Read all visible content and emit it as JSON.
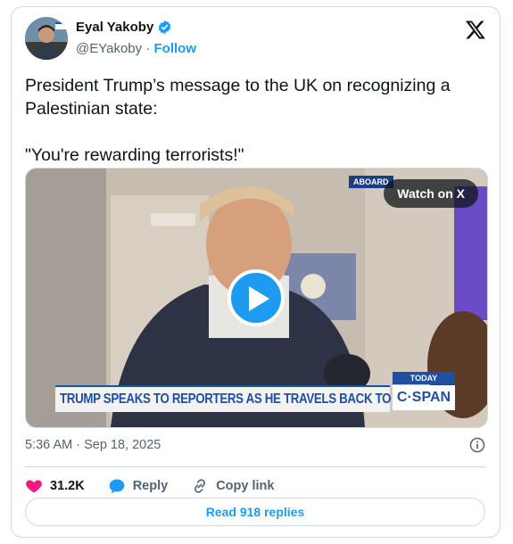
{
  "author": {
    "display_name": "Eyal Yakoby",
    "handle": "@EYakoby",
    "separator": "·",
    "follow_label": "Follow"
  },
  "tweet": {
    "text": "President Trump’s message to the UK on recognizing a Palestinian state:\n\n\"You're rewarding terrorists!\""
  },
  "media": {
    "watch_label": "Watch on X",
    "aboard_tag": "ABOARD",
    "chyron": "TRUMP SPEAKS TO REPORTERS AS HE TRAVELS BACK TO U.S.",
    "today_tag": "TODAY",
    "network": "C·SPAN"
  },
  "meta": {
    "timestamp": "5:36 AM · Sep 18, 2025"
  },
  "actions": {
    "likes": "31.2K",
    "reply_label": "Reply",
    "copy_label": "Copy link"
  },
  "replies_button": "Read 918 replies",
  "colors": {
    "accent": "#1d9bf0",
    "like": "#f91880",
    "text": "#0f1419",
    "muted": "#536471"
  }
}
